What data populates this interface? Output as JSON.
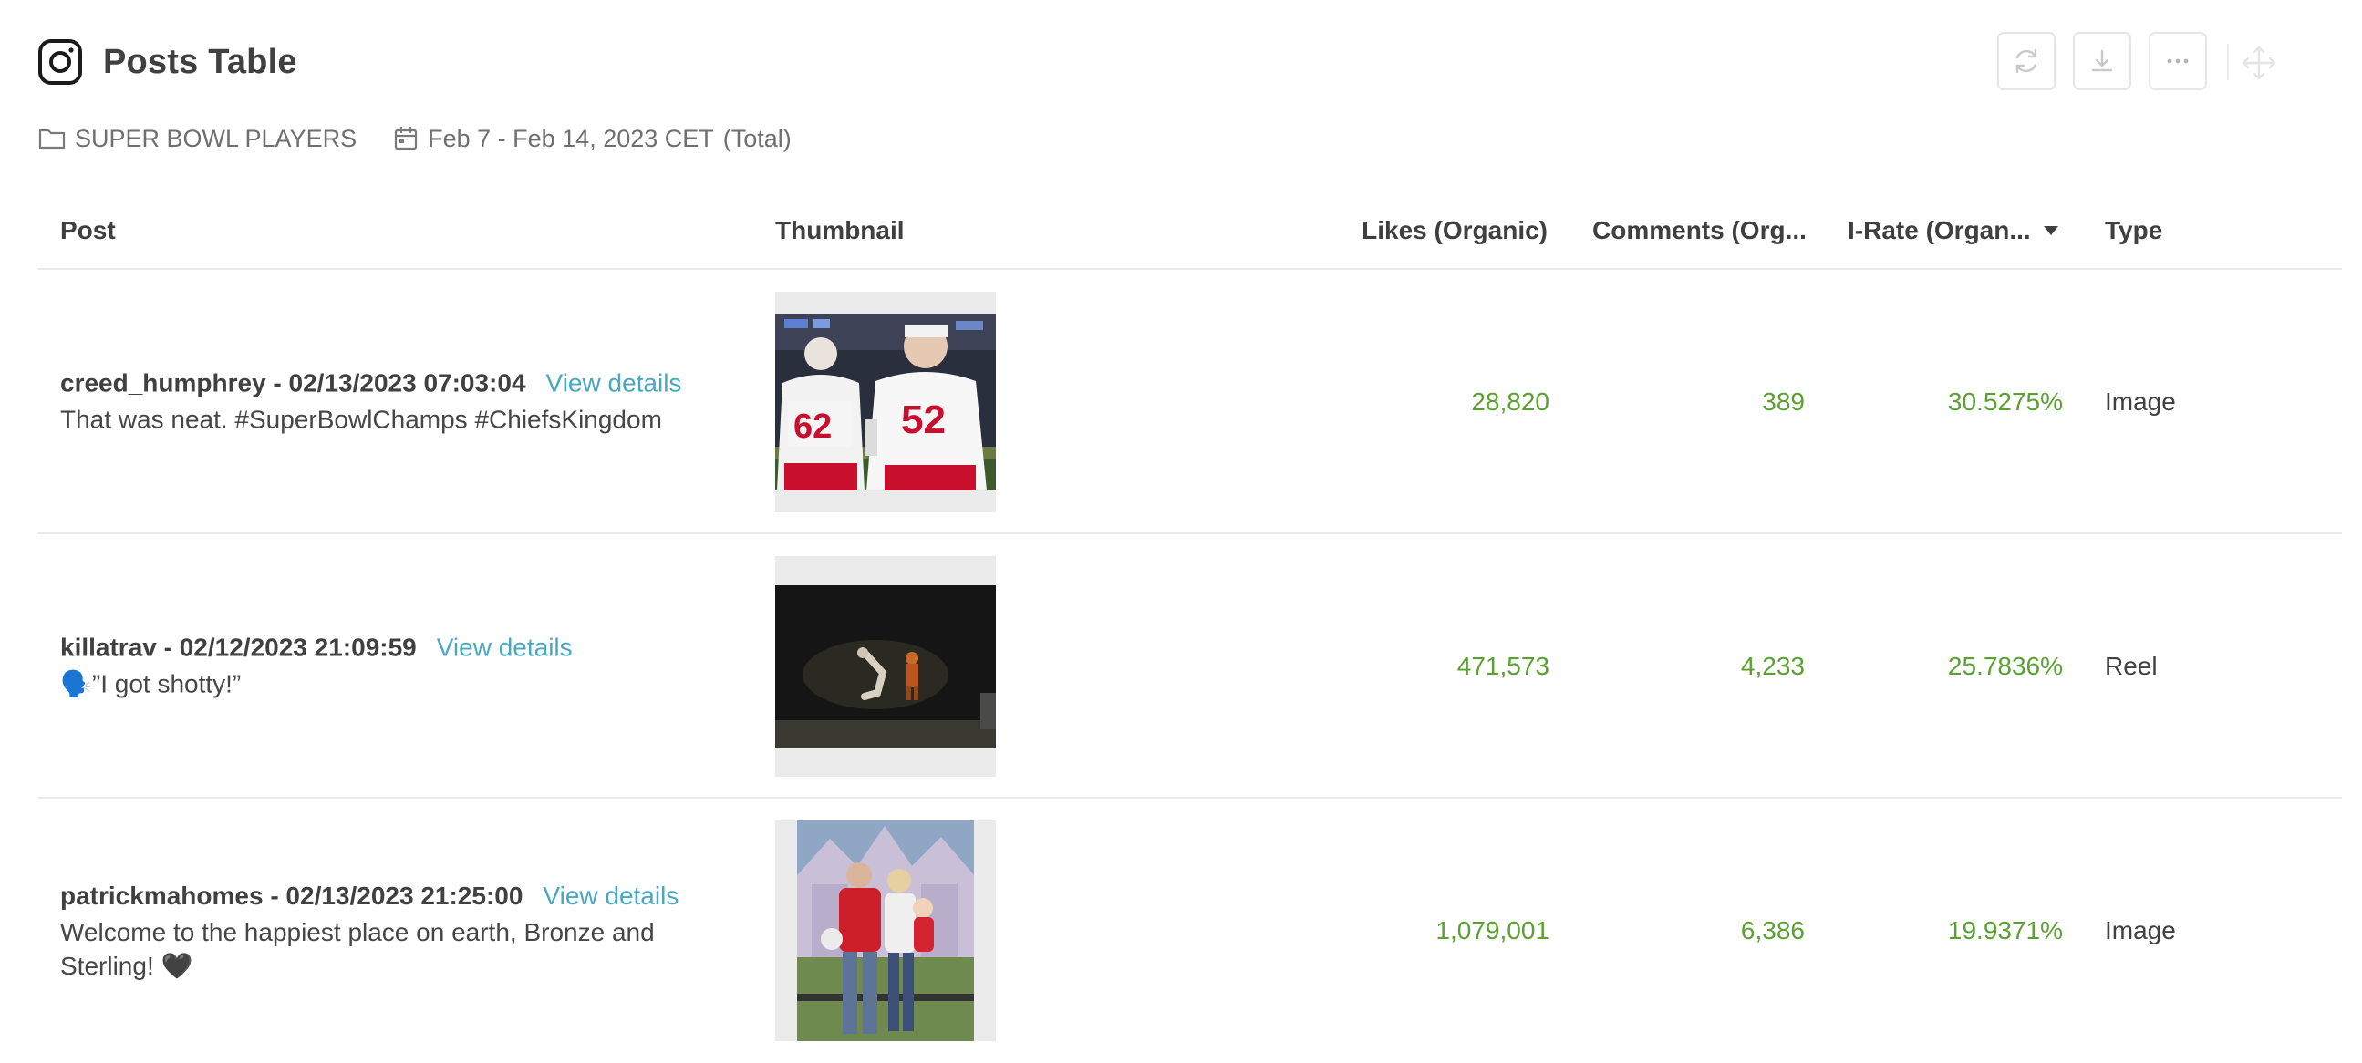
{
  "header": {
    "title": "Posts Table",
    "icon": "instagram-icon"
  },
  "toolbar": {
    "refresh_icon": "refresh-icon",
    "download_icon": "download-icon",
    "more_icon": "more-icon",
    "move_icon": "move-icon"
  },
  "filters": {
    "folder": "SUPER BOWL PLAYERS",
    "date_range": "Feb 7 - Feb 14, 2023 CET",
    "aggregation": "(Total)"
  },
  "table": {
    "columns": {
      "post": "Post",
      "thumbnail": "Thumbnail",
      "likes": "Likes (Organic)",
      "comments": "Comments (Org...",
      "irate": "I-Rate (Organ...",
      "type": "Type"
    },
    "view_details_label": "View details",
    "rows": [
      {
        "meta": "creed_humphrey - 02/13/2023 07:03:04",
        "view_details": "View details",
        "text": "That was neat. #SuperBowlChamps #ChiefsKingdom",
        "likes": "28,820",
        "comments": "389",
        "irate": "30.5275%",
        "type": "Image"
      },
      {
        "meta": "killatrav - 02/12/2023 21:09:59",
        "view_details": "View details",
        "text": "🗣️”I got shotty!”",
        "likes": "471,573",
        "comments": "4,233",
        "irate": "25.7836%",
        "type": "Reel"
      },
      {
        "meta": "patrickmahomes - 02/13/2023 21:25:00",
        "view_details": "View details",
        "text": "Welcome to the happiest place on earth, Bronze and Sterling! 🖤",
        "likes": "1,079,001",
        "comments": "6,386",
        "irate": "19.9371%",
        "type": "Image"
      }
    ]
  },
  "colors": {
    "metric_green": "#5aa132",
    "link_blue": "#4aa7c2",
    "text_dark": "#404040",
    "text_muted": "#6f6f6f"
  }
}
